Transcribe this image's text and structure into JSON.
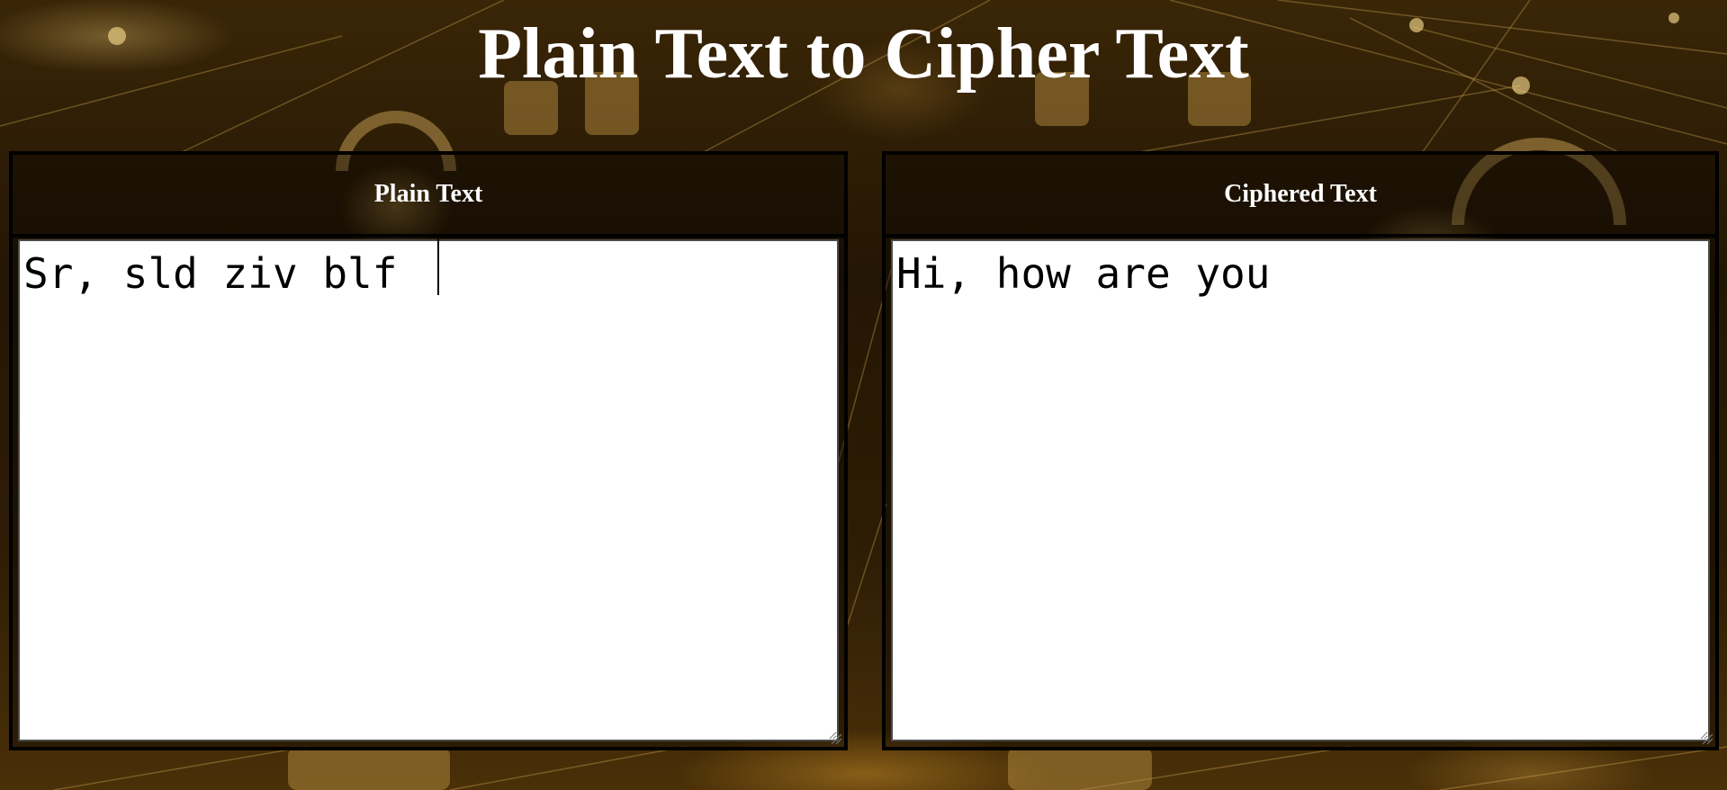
{
  "page": {
    "title": "Plain Text to Cipher Text"
  },
  "plain_panel": {
    "header": "Plain Text",
    "value": "Sr, sld ziv blf"
  },
  "cipher_panel": {
    "header": "Ciphered Text",
    "value": "Hi, how are you"
  },
  "colors": {
    "title": "#ffffff",
    "panel_border": "#000000",
    "textbox_bg": "#ffffff",
    "background_accent": "#c8a050"
  },
  "icons": {
    "resize_handle": "resize-grip-icon"
  }
}
